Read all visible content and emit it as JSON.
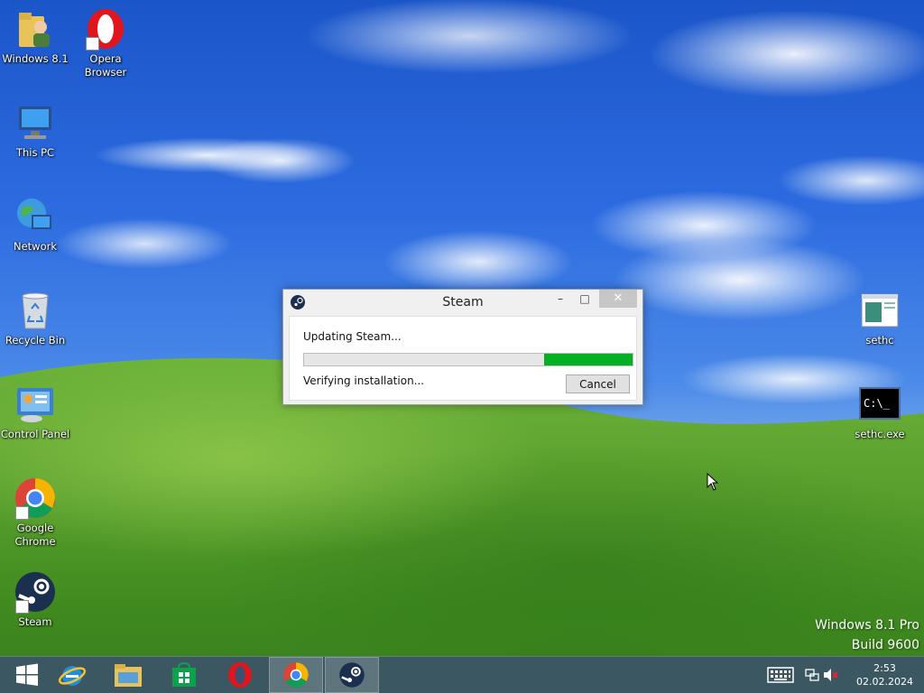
{
  "desktop": {
    "icons": [
      {
        "label": "Windows 8.1"
      },
      {
        "label": "Opera Browser"
      },
      {
        "label": "This PC"
      },
      {
        "label": "Network"
      },
      {
        "label": "Recycle Bin"
      },
      {
        "label": "Control Panel"
      },
      {
        "label": "Google Chrome"
      },
      {
        "label": "Steam"
      },
      {
        "label": "sethc"
      },
      {
        "label": "sethc.exe"
      }
    ],
    "watermark": {
      "line1": "Windows 8.1 Pro",
      "line2": "Build 9600"
    }
  },
  "steam_dialog": {
    "title": "Steam",
    "status": "Updating Steam...",
    "substatus": "Verifying installation...",
    "cancel_label": "Cancel",
    "progress_fraction": 0.27,
    "progress_color": "#06b025"
  },
  "taskbar": {
    "items": [
      {
        "icon": "windows-start-icon"
      },
      {
        "icon": "internet-explorer-icon"
      },
      {
        "icon": "file-explorer-icon"
      },
      {
        "icon": "windows-store-icon"
      },
      {
        "icon": "opera-icon"
      },
      {
        "icon": "chrome-icon",
        "active": true
      },
      {
        "icon": "steam-icon",
        "active": true
      }
    ],
    "clock": {
      "time": "2:53",
      "date": "02.02.2024"
    }
  }
}
